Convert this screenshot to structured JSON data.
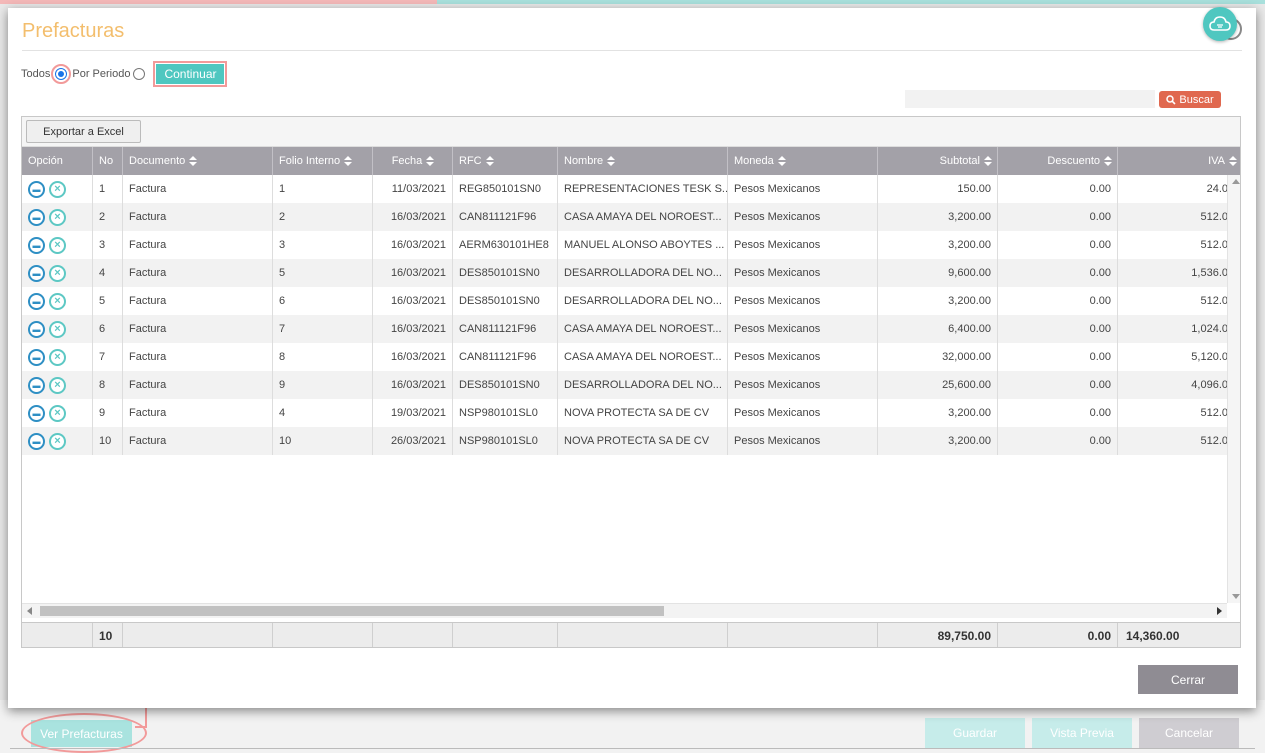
{
  "modal": {
    "title": "Prefacturas",
    "filter": {
      "option_all": "Todos",
      "option_period": "Por Periodo",
      "selected": "Todos",
      "continue_label": "Continuar"
    },
    "search": {
      "placeholder": "",
      "button_label": "Buscar"
    },
    "export_label": "Exportar a Excel",
    "close_label": "Cerrar"
  },
  "table": {
    "columns": [
      "Opción",
      "No",
      "Documento",
      "Folio Interno",
      "Fecha",
      "RFC",
      "Nombre",
      "Moneda",
      "Subtotal",
      "Descuento",
      "IVA"
    ],
    "rows": [
      {
        "no": "1",
        "documento": "Factura",
        "folio": "1",
        "fecha": "11/03/2021",
        "rfc": "REG850101SN0",
        "nombre": "REPRESENTACIONES TESK S...",
        "moneda": "Pesos Mexicanos",
        "subtotal": "150.00",
        "descuento": "0.00",
        "iva": "24.0"
      },
      {
        "no": "2",
        "documento": "Factura",
        "folio": "2",
        "fecha": "16/03/2021",
        "rfc": "CAN811121F96",
        "nombre": "CASA AMAYA DEL NOROEST...",
        "moneda": "Pesos Mexicanos",
        "subtotal": "3,200.00",
        "descuento": "0.00",
        "iva": "512.0"
      },
      {
        "no": "3",
        "documento": "Factura",
        "folio": "3",
        "fecha": "16/03/2021",
        "rfc": "AERM630101HE8",
        "nombre": "MANUEL ALONSO ABOYTES ...",
        "moneda": "Pesos Mexicanos",
        "subtotal": "3,200.00",
        "descuento": "0.00",
        "iva": "512.0"
      },
      {
        "no": "4",
        "documento": "Factura",
        "folio": "5",
        "fecha": "16/03/2021",
        "rfc": "DES850101SN0",
        "nombre": "DESARROLLADORA DEL NO...",
        "moneda": "Pesos Mexicanos",
        "subtotal": "9,600.00",
        "descuento": "0.00",
        "iva": "1,536.0"
      },
      {
        "no": "5",
        "documento": "Factura",
        "folio": "6",
        "fecha": "16/03/2021",
        "rfc": "DES850101SN0",
        "nombre": "DESARROLLADORA DEL NO...",
        "moneda": "Pesos Mexicanos",
        "subtotal": "3,200.00",
        "descuento": "0.00",
        "iva": "512.0"
      },
      {
        "no": "6",
        "documento": "Factura",
        "folio": "7",
        "fecha": "16/03/2021",
        "rfc": "CAN811121F96",
        "nombre": "CASA AMAYA DEL NOROEST...",
        "moneda": "Pesos Mexicanos",
        "subtotal": "6,400.00",
        "descuento": "0.00",
        "iva": "1,024.0"
      },
      {
        "no": "7",
        "documento": "Factura",
        "folio": "8",
        "fecha": "16/03/2021",
        "rfc": "CAN811121F96",
        "nombre": "CASA AMAYA DEL NOROEST...",
        "moneda": "Pesos Mexicanos",
        "subtotal": "32,000.00",
        "descuento": "0.00",
        "iva": "5,120.0"
      },
      {
        "no": "8",
        "documento": "Factura",
        "folio": "9",
        "fecha": "16/03/2021",
        "rfc": "DES850101SN0",
        "nombre": "DESARROLLADORA DEL NO...",
        "moneda": "Pesos Mexicanos",
        "subtotal": "25,600.00",
        "descuento": "0.00",
        "iva": "4,096.0"
      },
      {
        "no": "9",
        "documento": "Factura",
        "folio": "4",
        "fecha": "19/03/2021",
        "rfc": "NSP980101SL0",
        "nombre": "NOVA PROTECTA SA DE CV",
        "moneda": "Pesos Mexicanos",
        "subtotal": "3,200.00",
        "descuento": "0.00",
        "iva": "512.0"
      },
      {
        "no": "10",
        "documento": "Factura",
        "folio": "10",
        "fecha": "26/03/2021",
        "rfc": "NSP980101SL0",
        "nombre": "NOVA PROTECTA SA DE CV",
        "moneda": "Pesos Mexicanos",
        "subtotal": "3,200.00",
        "descuento": "0.00",
        "iva": "512.0"
      }
    ],
    "totals": {
      "count": "10",
      "subtotal": "89,750.00",
      "descuento": "0.00",
      "iva": "14,360.00"
    }
  },
  "page": {
    "ver_label": "Ver Prefacturas",
    "guardar_label": "Guardar",
    "vista_label": "Vista Previa",
    "cancelar_label": "Cancelar"
  },
  "colors": {
    "accent": "#4fc7c0",
    "title": "#f3be6d",
    "header": "#a3a1a8",
    "search_button": "#e0684f",
    "highlight": "#f29a9a"
  }
}
